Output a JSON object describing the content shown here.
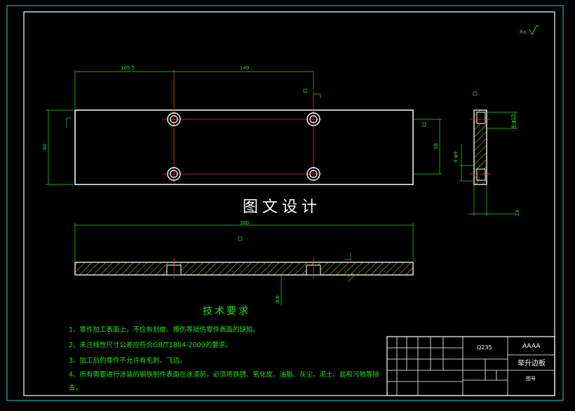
{
  "drawing": {
    "watermark": "图文设计",
    "surface_symbol": "Ra",
    "dims": {
      "d1": "105.5",
      "d2": "149",
      "d3": "80",
      "d4": "58",
      "d5": "380",
      "d6": "8.6",
      "d7": "4-φ9",
      "d8": "4-φ15",
      "d9": "14"
    }
  },
  "tech_req": {
    "title": "技术要求",
    "notes": [
      "1、零件加工表面上，不应有划痕、擦伤等损伤零件表面的缺陷。",
      "2、未注线性尺寸公差应符合GB/T1804-2000的要求。",
      "3、加工后的零件不允许有毛刺、飞边。",
      "4、所有需要进行涂装的钢铁制件表面在涂漆前，必须将铁锈、氧化皮、油脂、灰尘、泥土、盐和污物等除",
      "去。"
    ]
  },
  "title_block": {
    "material": "Q235",
    "company": "AAAA",
    "part_name": "举升边板",
    "drawing_no_label": "图号"
  },
  "colors": {
    "background": "#000000",
    "outline": "#ffffff",
    "annotation": "#20e020",
    "center": "#ff3030",
    "hatch": "#d0d000",
    "hidden": "#00c0c0"
  }
}
